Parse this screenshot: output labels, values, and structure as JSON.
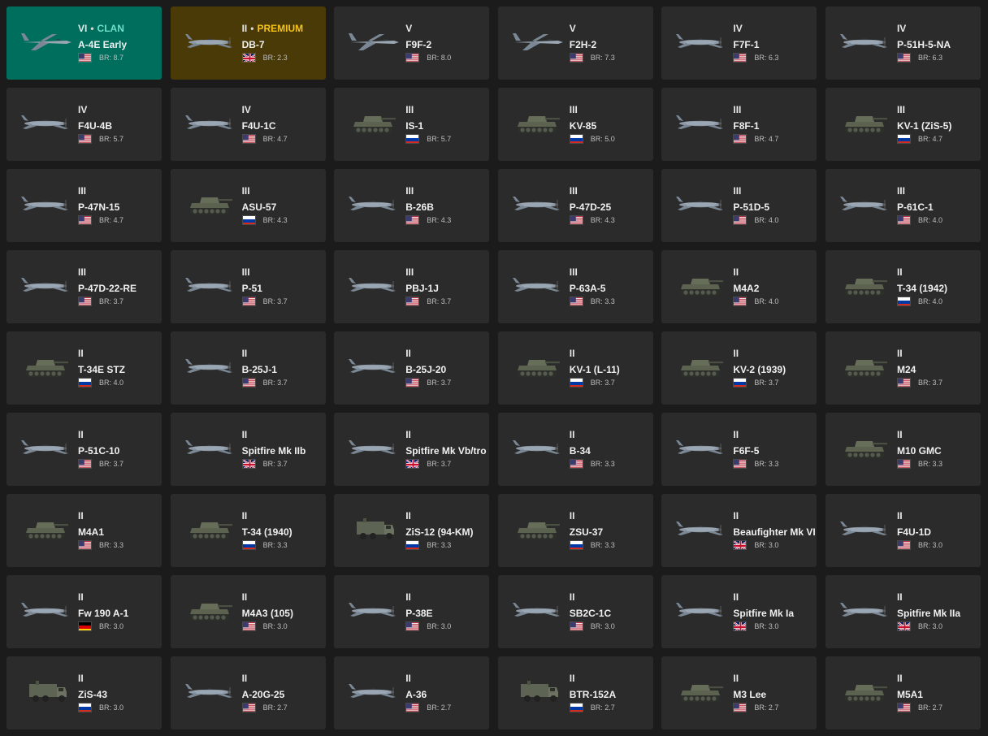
{
  "vehicles": [
    {
      "tier": "VI",
      "tag": "CLAN",
      "tag_type": "clan",
      "name": "A-4E Early",
      "flag": "us",
      "br_label": "BR: 8.7",
      "kind": "jet"
    },
    {
      "tier": "II",
      "tag": "PREMIUM",
      "tag_type": "premium",
      "name": "DB-7",
      "flag": "uk",
      "br_label": "BR: 2.3",
      "kind": "plane"
    },
    {
      "tier": "V",
      "name": "F9F-2",
      "flag": "us",
      "br_label": "BR: 8.0",
      "kind": "jet"
    },
    {
      "tier": "V",
      "name": "F2H-2",
      "flag": "us",
      "br_label": "BR: 7.3",
      "kind": "jet"
    },
    {
      "tier": "IV",
      "name": "F7F-1",
      "flag": "us",
      "br_label": "BR: 6.3",
      "kind": "plane"
    },
    {
      "tier": "IV",
      "name": "P-51H-5-NA",
      "flag": "us",
      "br_label": "BR: 6.3",
      "kind": "plane"
    },
    {
      "tier": "IV",
      "name": "F4U-4B",
      "flag": "us",
      "br_label": "BR: 5.7",
      "kind": "plane"
    },
    {
      "tier": "IV",
      "name": "F4U-1C",
      "flag": "us",
      "br_label": "BR: 4.7",
      "kind": "plane"
    },
    {
      "tier": "III",
      "name": "IS-1",
      "flag": "ru",
      "br_label": "BR: 5.7",
      "kind": "tank"
    },
    {
      "tier": "III",
      "name": "KV-85",
      "flag": "ru",
      "br_label": "BR: 5.0",
      "kind": "tank"
    },
    {
      "tier": "III",
      "name": "F8F-1",
      "flag": "us",
      "br_label": "BR: 4.7",
      "kind": "plane"
    },
    {
      "tier": "III",
      "name": "KV-1 (ZiS-5)",
      "flag": "ru",
      "br_label": "BR: 4.7",
      "kind": "tank"
    },
    {
      "tier": "III",
      "name": "P-47N-15",
      "flag": "us",
      "br_label": "BR: 4.7",
      "kind": "plane"
    },
    {
      "tier": "III",
      "name": "ASU-57",
      "flag": "ru",
      "br_label": "BR: 4.3",
      "kind": "tank"
    },
    {
      "tier": "III",
      "name": "B-26B",
      "flag": "us",
      "br_label": "BR: 4.3",
      "kind": "plane"
    },
    {
      "tier": "III",
      "name": "P-47D-25",
      "flag": "us",
      "br_label": "BR: 4.3",
      "kind": "plane"
    },
    {
      "tier": "III",
      "name": "P-51D-5",
      "flag": "us",
      "br_label": "BR: 4.0",
      "kind": "plane"
    },
    {
      "tier": "III",
      "name": "P-61C-1",
      "flag": "us",
      "br_label": "BR: 4.0",
      "kind": "plane"
    },
    {
      "tier": "III",
      "name": "P-47D-22-RE",
      "flag": "us",
      "br_label": "BR: 3.7",
      "kind": "plane"
    },
    {
      "tier": "III",
      "name": "P-51",
      "flag": "us",
      "br_label": "BR: 3.7",
      "kind": "plane"
    },
    {
      "tier": "III",
      "name": "PBJ-1J",
      "flag": "us",
      "br_label": "BR: 3.7",
      "kind": "plane"
    },
    {
      "tier": "III",
      "name": "P-63A-5",
      "flag": "us",
      "br_label": "BR: 3.3",
      "kind": "plane"
    },
    {
      "tier": "II",
      "name": "M4A2",
      "flag": "us",
      "br_label": "BR: 4.0",
      "kind": "tank"
    },
    {
      "tier": "II",
      "name": "T-34 (1942)",
      "flag": "ru",
      "br_label": "BR: 4.0",
      "kind": "tank"
    },
    {
      "tier": "II",
      "name": "T-34E STZ",
      "flag": "ru",
      "br_label": "BR: 4.0",
      "kind": "tank"
    },
    {
      "tier": "II",
      "name": "B-25J-1",
      "flag": "us",
      "br_label": "BR: 3.7",
      "kind": "plane"
    },
    {
      "tier": "II",
      "name": "B-25J-20",
      "flag": "us",
      "br_label": "BR: 3.7",
      "kind": "plane"
    },
    {
      "tier": "II",
      "name": "KV-1 (L-11)",
      "flag": "ru",
      "br_label": "BR: 3.7",
      "kind": "tank"
    },
    {
      "tier": "II",
      "name": "KV-2 (1939)",
      "flag": "ru",
      "br_label": "BR: 3.7",
      "kind": "tank"
    },
    {
      "tier": "II",
      "name": "M24",
      "flag": "us",
      "br_label": "BR: 3.7",
      "kind": "tank"
    },
    {
      "tier": "II",
      "name": "P-51C-10",
      "flag": "us",
      "br_label": "BR: 3.7",
      "kind": "plane"
    },
    {
      "tier": "II",
      "name": "Spitfire Mk IIb",
      "flag": "uk",
      "br_label": "BR: 3.7",
      "kind": "plane"
    },
    {
      "tier": "II",
      "name": "Spitfire Mk Vb/tro",
      "flag": "uk",
      "br_label": "BR: 3.7",
      "kind": "plane"
    },
    {
      "tier": "II",
      "name": "B-34",
      "flag": "us",
      "br_label": "BR: 3.3",
      "kind": "plane"
    },
    {
      "tier": "II",
      "name": "F6F-5",
      "flag": "us",
      "br_label": "BR: 3.3",
      "kind": "plane"
    },
    {
      "tier": "II",
      "name": "M10 GMC",
      "flag": "us",
      "br_label": "BR: 3.3",
      "kind": "tank"
    },
    {
      "tier": "II",
      "name": "M4A1",
      "flag": "us",
      "br_label": "BR: 3.3",
      "kind": "tank"
    },
    {
      "tier": "II",
      "name": "T-34 (1940)",
      "flag": "ru",
      "br_label": "BR: 3.3",
      "kind": "tank"
    },
    {
      "tier": "II",
      "name": "ZiS-12 (94-KM)",
      "flag": "ru",
      "br_label": "BR: 3.3",
      "kind": "truck"
    },
    {
      "tier": "II",
      "name": "ZSU-37",
      "flag": "ru",
      "br_label": "BR: 3.3",
      "kind": "tank"
    },
    {
      "tier": "II",
      "name": "Beaufighter Mk VI",
      "flag": "uk",
      "br_label": "BR: 3.0",
      "kind": "plane"
    },
    {
      "tier": "II",
      "name": "F4U-1D",
      "flag": "us",
      "br_label": "BR: 3.0",
      "kind": "plane"
    },
    {
      "tier": "II",
      "name": "Fw 190 A-1",
      "flag": "de",
      "br_label": "BR: 3.0",
      "kind": "plane"
    },
    {
      "tier": "II",
      "name": "M4A3 (105)",
      "flag": "us",
      "br_label": "BR: 3.0",
      "kind": "tank"
    },
    {
      "tier": "II",
      "name": "P-38E",
      "flag": "us",
      "br_label": "BR: 3.0",
      "kind": "plane"
    },
    {
      "tier": "II",
      "name": "SB2C-1C",
      "flag": "us",
      "br_label": "BR: 3.0",
      "kind": "plane"
    },
    {
      "tier": "II",
      "name": "Spitfire Mk Ia",
      "flag": "uk",
      "br_label": "BR: 3.0",
      "kind": "plane"
    },
    {
      "tier": "II",
      "name": "Spitfire Mk IIa",
      "flag": "uk",
      "br_label": "BR: 3.0",
      "kind": "plane"
    },
    {
      "tier": "II",
      "name": "ZiS-43",
      "flag": "ru",
      "br_label": "BR: 3.0",
      "kind": "truck"
    },
    {
      "tier": "II",
      "name": "A-20G-25",
      "flag": "us",
      "br_label": "BR: 2.7",
      "kind": "plane"
    },
    {
      "tier": "II",
      "name": "A-36",
      "flag": "us",
      "br_label": "BR: 2.7",
      "kind": "plane"
    },
    {
      "tier": "II",
      "name": "BTR-152A",
      "flag": "ru",
      "br_label": "BR: 2.7",
      "kind": "truck"
    },
    {
      "tier": "II",
      "name": "M3 Lee",
      "flag": "us",
      "br_label": "BR: 2.7",
      "kind": "tank"
    },
    {
      "tier": "II",
      "name": "M5A1",
      "flag": "us",
      "br_label": "BR: 2.7",
      "kind": "tank"
    }
  ],
  "tag_separator": "•",
  "colors": {
    "card": "#2b2b2b",
    "clan_card": "#006e5c",
    "premium_card": "#4a3a07",
    "clan_tag": "#6ee0c8",
    "premium_tag": "#f3c21b"
  }
}
